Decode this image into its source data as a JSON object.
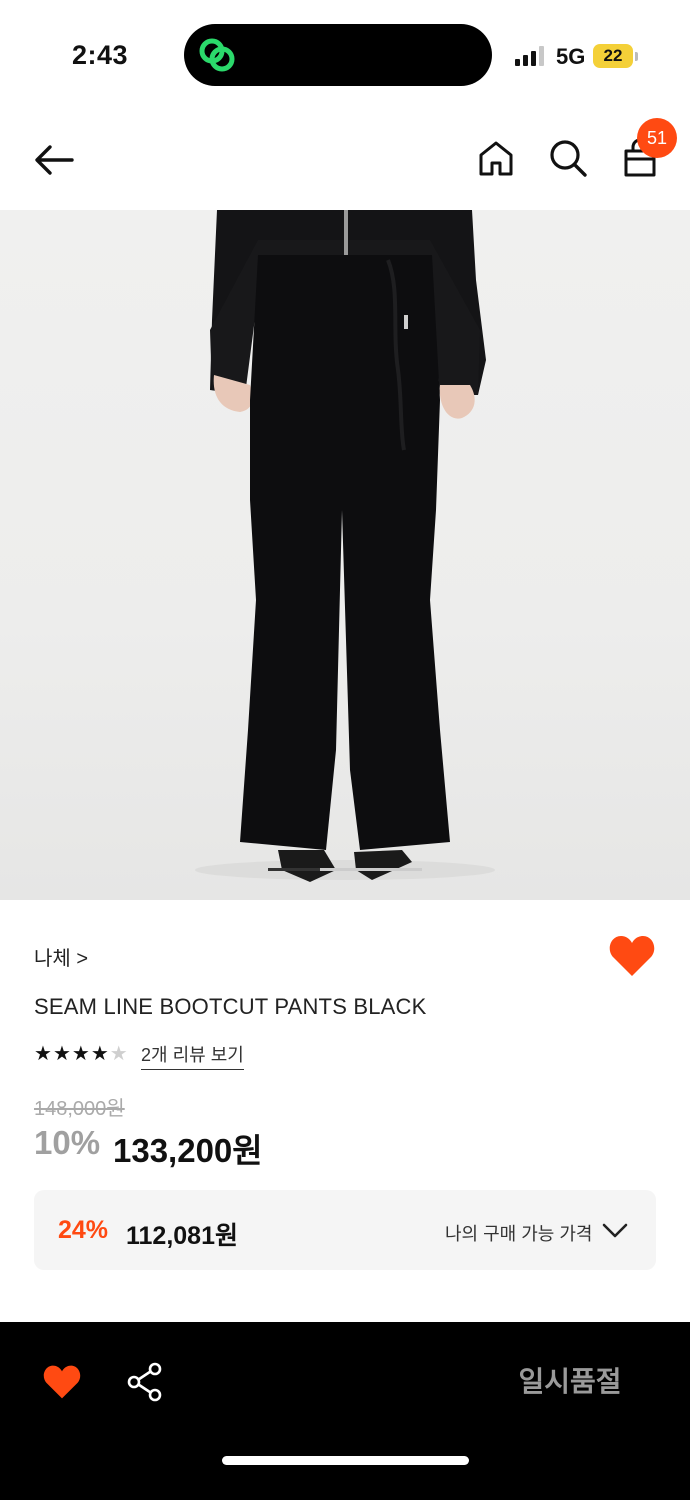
{
  "status_bar": {
    "time": "2:43",
    "network": "5G",
    "battery": "22"
  },
  "header": {
    "cart_count": "51"
  },
  "product": {
    "brand": "나체 >",
    "name": "SEAM LINE BOOTCUT PANTS BLACK",
    "rating": 4,
    "rating_max": 5,
    "review_link": "2개 리뷰 보기",
    "original_price": "148,000원",
    "discount_rate": "10%",
    "sale_price": "133,200원",
    "wishlisted": true
  },
  "my_price": {
    "rate": "24%",
    "price": "112,081원",
    "label": "나의 구매 가능 가격"
  },
  "bottom_bar": {
    "soldout_label": "일시품절"
  },
  "colors": {
    "accent": "#ff4a12",
    "bottom_bar": "#000000",
    "badge": "#ff4a12"
  },
  "icons": [
    "app-logo-icon",
    "signal-icon",
    "back-arrow-icon",
    "home-icon",
    "search-icon",
    "shopping-bag-icon",
    "heart-icon",
    "share-icon",
    "chevron-down-icon"
  ]
}
